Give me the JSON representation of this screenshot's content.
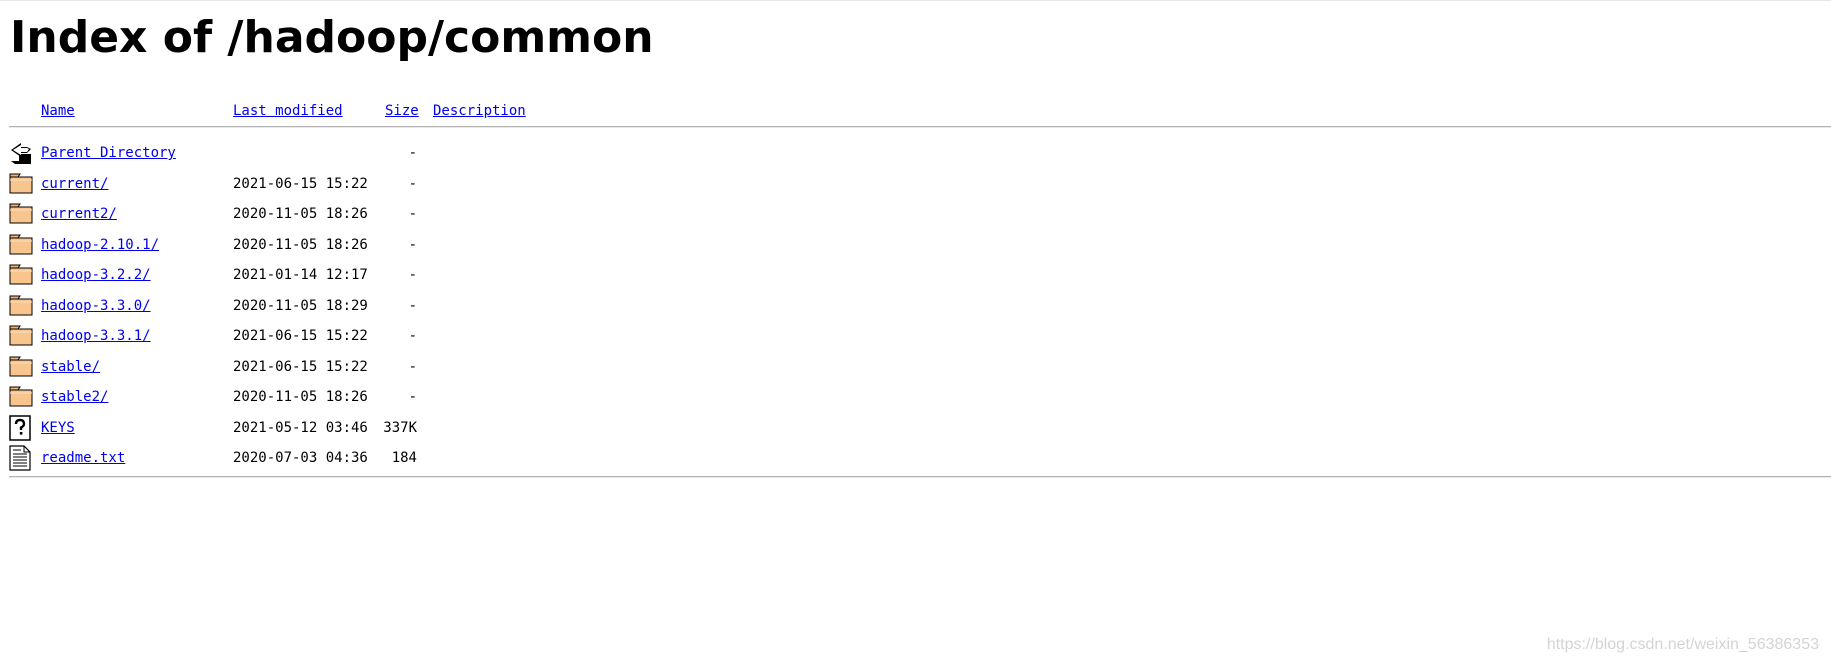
{
  "page": {
    "title": "Index of /hadoop/common"
  },
  "columns": {
    "name": "Name",
    "last_modified": "Last modified",
    "size": "Size",
    "description": "Description"
  },
  "entries": [
    {
      "icon": "back-icon",
      "name": "Parent Directory",
      "date": "",
      "size": "-"
    },
    {
      "icon": "folder-icon",
      "name": "current/",
      "date": "2021-06-15 15:22",
      "size": "-"
    },
    {
      "icon": "folder-icon",
      "name": "current2/",
      "date": "2020-11-05 18:26",
      "size": "-"
    },
    {
      "icon": "folder-icon",
      "name": "hadoop-2.10.1/",
      "date": "2020-11-05 18:26",
      "size": "-"
    },
    {
      "icon": "folder-icon",
      "name": "hadoop-3.2.2/",
      "date": "2021-01-14 12:17",
      "size": "-"
    },
    {
      "icon": "folder-icon",
      "name": "hadoop-3.3.0/",
      "date": "2020-11-05 18:29",
      "size": "-"
    },
    {
      "icon": "folder-icon",
      "name": "hadoop-3.3.1/",
      "date": "2021-06-15 15:22",
      "size": "-"
    },
    {
      "icon": "folder-icon",
      "name": "stable/",
      "date": "2021-06-15 15:22",
      "size": "-"
    },
    {
      "icon": "folder-icon",
      "name": "stable2/",
      "date": "2020-11-05 18:26",
      "size": "-"
    },
    {
      "icon": "unknown-file-icon",
      "name": "KEYS",
      "date": "2021-05-12 03:46",
      "size": "337K"
    },
    {
      "icon": "text-file-icon",
      "name": "readme.txt",
      "date": "2020-07-03 04:36",
      "size": "184"
    }
  ],
  "watermark": "https://blog.csdn.net/weixin_56386353",
  "colors": {
    "link": "#0000ee",
    "folder_fill": "#f6b26b",
    "rule": "#b3b3b3"
  }
}
